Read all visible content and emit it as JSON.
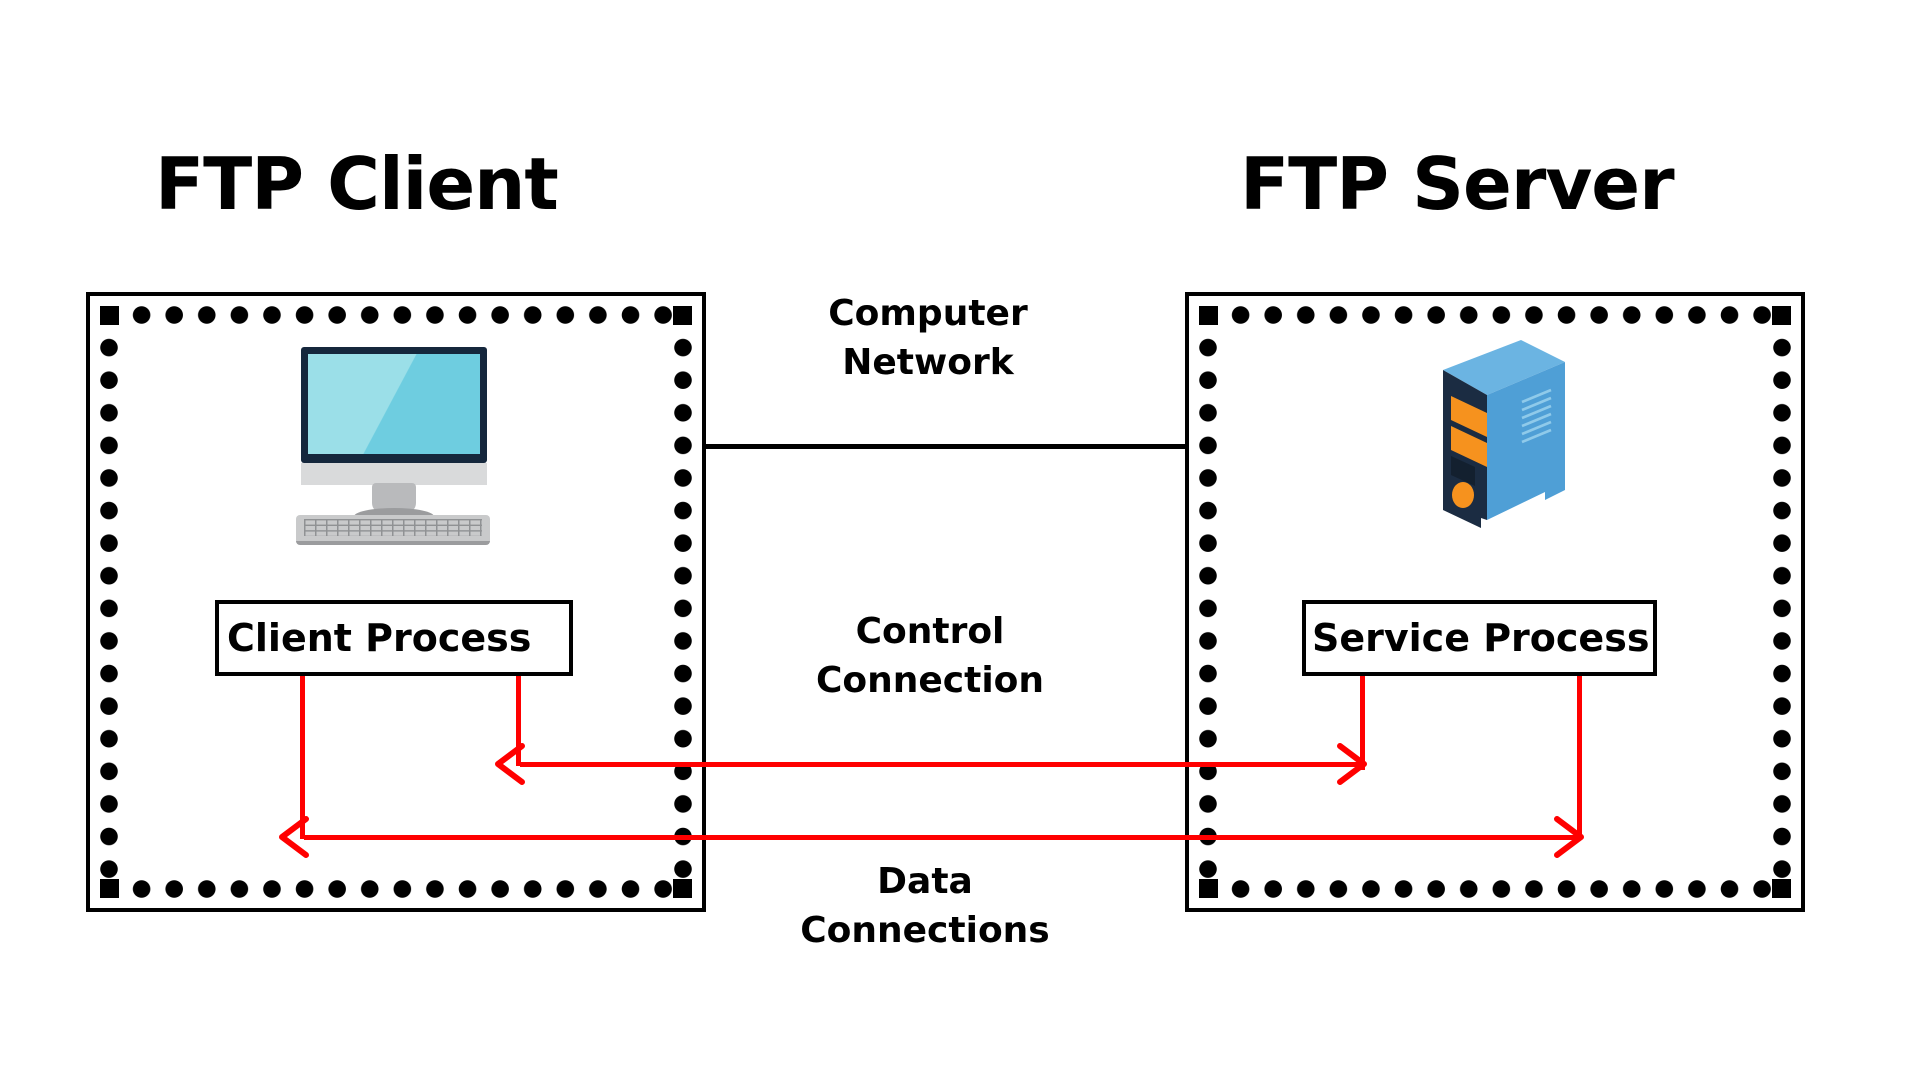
{
  "diagram": {
    "title_client": "FTP Client",
    "title_server": "FTP Server",
    "client_process_label": "Client Process",
    "server_process_label": "Service Process",
    "labels": {
      "network": "Computer\nNetwork",
      "control": "Control\nConnection",
      "data": "Data\nConnections"
    },
    "colors": {
      "line_black": "#000000",
      "line_red": "#ff0000",
      "background": "#ffffff",
      "monitor_bezel": "#15273c",
      "monitor_screen_light": "#9bdfe8",
      "monitor_screen_dark": "#6ecde0",
      "keyboard_gray": "#c9cacb",
      "server_side_blue": "#57a8dd",
      "server_top_blue": "#4f9fd6",
      "server_front_navy": "#1b2c42",
      "server_accent_orange": "#f6921e"
    },
    "icons": {
      "desktop_computer": "desktop-computer-icon",
      "server_tower": "server-tower-icon"
    }
  }
}
